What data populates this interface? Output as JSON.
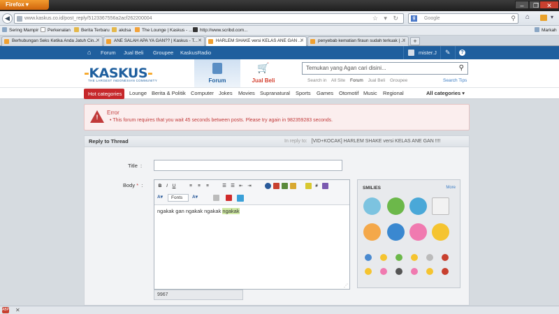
{
  "browser": {
    "app_button": "Firefox",
    "url": "www.kaskus.co.id/post_reply/5123367556a2acf262200004",
    "search_placeholder": "Google",
    "bookmarks_right": "Markah",
    "bookmarks": [
      "Sering Mampir",
      "Perkenalan",
      "Berita Terbaru",
      "akdsa",
      "The Lounge | Kaskus - ...",
      "http://www.scribd.com..."
    ],
    "tabs": [
      {
        "label": "Berhubungan Seks Ketika Anda Jatuh Cin...",
        "active": false
      },
      {
        "label": "ANE SALAH APA YA GAN?? | Kaskus - T...",
        "active": false
      },
      {
        "label": "HARLEM SHAKE versi KELAS ANE GAN ...",
        "active": true
      },
      {
        "label": "penyebab kematian firaun sudah terkuak | ...",
        "active": false
      }
    ]
  },
  "topnav": {
    "items": [
      "Forum",
      "Jual Beli",
      "Groupee",
      "KaskusRadio"
    ],
    "user": "mister.J"
  },
  "header": {
    "logo_left": "KASKUS",
    "tagline": "THE LARGEST INDONESIAN COMMUNITY",
    "forum_tab": "Forum",
    "jualbeli_tab": "Jual Beli",
    "search_placeholder": "Temukan yang Agan cari disini...",
    "search_in_label": "Search in",
    "search_options": [
      "All Site",
      "Forum",
      "Jual Beli",
      "Groupee"
    ],
    "search_tips": "Search Tips"
  },
  "categories": {
    "hot": "Hot categories",
    "items": [
      "Lounge",
      "Berita & Politik",
      "Computer",
      "Jokes",
      "Movies",
      "Supranatural",
      "Sports",
      "Games",
      "Otomotif",
      "Music",
      "Regional"
    ],
    "all": "All categories"
  },
  "error": {
    "title": "Error",
    "message": "This forum requires that you wait 45 seconds between posts. Please try again in 982359283 seconds."
  },
  "reply": {
    "heading": "Reply to Thread",
    "in_reply_to_label": "In reply to:",
    "in_reply_to": "[VID+KOCAK] HARLEM SHAKE versi KELAS ANE GAN !!!!",
    "title_label": "Title",
    "title_value": "",
    "body_label": "Body",
    "font_select": "Fonts",
    "body_text_plain": "ngakak gan  ngakak ngakak ",
    "body_text_highlight": "ngakak",
    "char_count": "9967",
    "smilies_label": "SMILIES",
    "smilies_more": "More"
  },
  "colors": {
    "kaskus_blue": "#1f5f9e",
    "hot_red": "#c6282b",
    "error_red": "#c13a3a",
    "error_bg": "#fbeeee"
  }
}
